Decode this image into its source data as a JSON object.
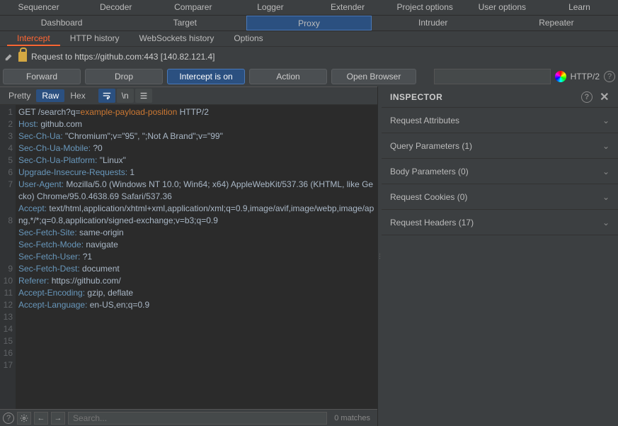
{
  "tabs1": [
    "Sequencer",
    "Decoder",
    "Comparer",
    "Logger",
    "Extender",
    "Project options",
    "User options",
    "Learn"
  ],
  "tabs2": [
    {
      "label": "Dashboard",
      "active": false
    },
    {
      "label": "Target",
      "active": false
    },
    {
      "label": "Proxy",
      "active": true
    },
    {
      "label": "Intruder",
      "active": false
    },
    {
      "label": "Repeater",
      "active": false
    }
  ],
  "tabs3": [
    {
      "label": "Intercept",
      "active": true
    },
    {
      "label": "HTTP history",
      "active": false
    },
    {
      "label": "WebSockets history",
      "active": false
    },
    {
      "label": "Options",
      "active": false
    }
  ],
  "request_label": "Request to https://github.com:443  [140.82.121.4]",
  "actions": {
    "forward": "Forward",
    "drop": "Drop",
    "intercept": "Intercept is on",
    "action": "Action",
    "open_browser": "Open Browser"
  },
  "http_version_label": "HTTP/2",
  "view_tabs": [
    {
      "label": "Pretty",
      "active": false
    },
    {
      "label": "Raw",
      "active": true
    },
    {
      "label": "Hex",
      "active": false
    }
  ],
  "http": {
    "method": "GET",
    "path_prefix": "/search?q=",
    "payload": "example-payload-position",
    "protocol": "HTTP/2",
    "headers": [
      {
        "name": "Host:",
        "value": " github.com"
      },
      {
        "name": "Sec-Ch-Ua:",
        "value": " \"Chromium\";v=\"95\", \";Not A Brand\";v=\"99\""
      },
      {
        "name": "Sec-Ch-Ua-Mobile:",
        "value": " ?0"
      },
      {
        "name": "Sec-Ch-Ua-Platform:",
        "value": " \"Linux\""
      },
      {
        "name": "Upgrade-Insecure-Requests:",
        "value": " 1"
      },
      {
        "name": "User-Agent:",
        "value": " Mozilla/5.0 (Windows NT 10.0; Win64; x64) AppleWebKit/537.36 (KHTML, like Gecko) Chrome/95.0.4638.69 Safari/537.36"
      },
      {
        "name": "Accept:",
        "value": " text/html,application/xhtml+xml,application/xml;q=0.9,image/avif,image/webp,image/apng,*/*;q=0.8,application/signed-exchange;v=b3;q=0.9"
      },
      {
        "name": "Sec-Fetch-Site:",
        "value": " same-origin"
      },
      {
        "name": "Sec-Fetch-Mode:",
        "value": " navigate"
      },
      {
        "name": "Sec-Fetch-User:",
        "value": " ?1"
      },
      {
        "name": "Sec-Fetch-Dest:",
        "value": " document"
      },
      {
        "name": "Referer:",
        "value": " https://github.com/"
      },
      {
        "name": "Accept-Encoding:",
        "value": " gzip, deflate"
      },
      {
        "name": "Accept-Language:",
        "value": " en-US,en;q=0.9"
      }
    ]
  },
  "search_placeholder": "Search...",
  "matches_label": "0 matches",
  "inspector": {
    "title": "INSPECTOR",
    "sections": [
      "Request Attributes",
      "Query Parameters (1)",
      "Body Parameters (0)",
      "Request Cookies (0)",
      "Request Headers (17)"
    ]
  }
}
